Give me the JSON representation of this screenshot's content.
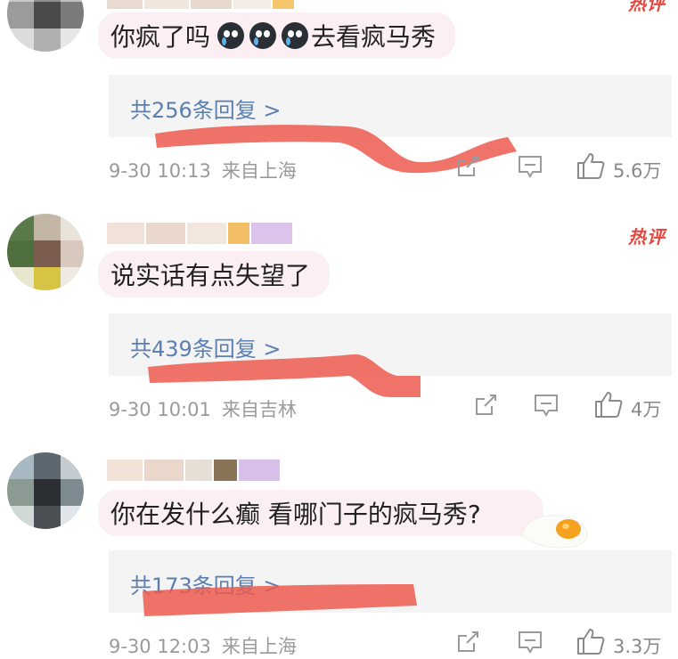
{
  "comments": [
    {
      "text": "你疯了吗",
      "text_after_emoji": "去看疯马秀",
      "emoji": [
        "crying-face-icon",
        "crying-face-icon",
        "crying-face-icon"
      ],
      "reply_link": "共256条回复 >",
      "date": "9-30 10:13",
      "location": "来自上海",
      "likes": "5.6万",
      "hot_badge": "热评"
    },
    {
      "text": "说实话有点失望了",
      "reply_link": "共439条回复 >",
      "date": "9-30 10:01",
      "location": "来自吉林",
      "likes": "4万",
      "hot_badge": "热评"
    },
    {
      "text": "你在发什么癫 看哪门子的疯马秀?",
      "reply_link": "共173条回复 >",
      "date": "9-30 12:03",
      "location": "来自上海",
      "likes": "3.3万"
    }
  ],
  "colors": {
    "bubble_bg": "#fbeff3",
    "reply_bg": "#f4f4f4",
    "reply_link": "#5b7fb0",
    "scribble": "#ec5a4e",
    "hot_badge": "#e2483f",
    "meta_text": "#9a9a9a"
  }
}
